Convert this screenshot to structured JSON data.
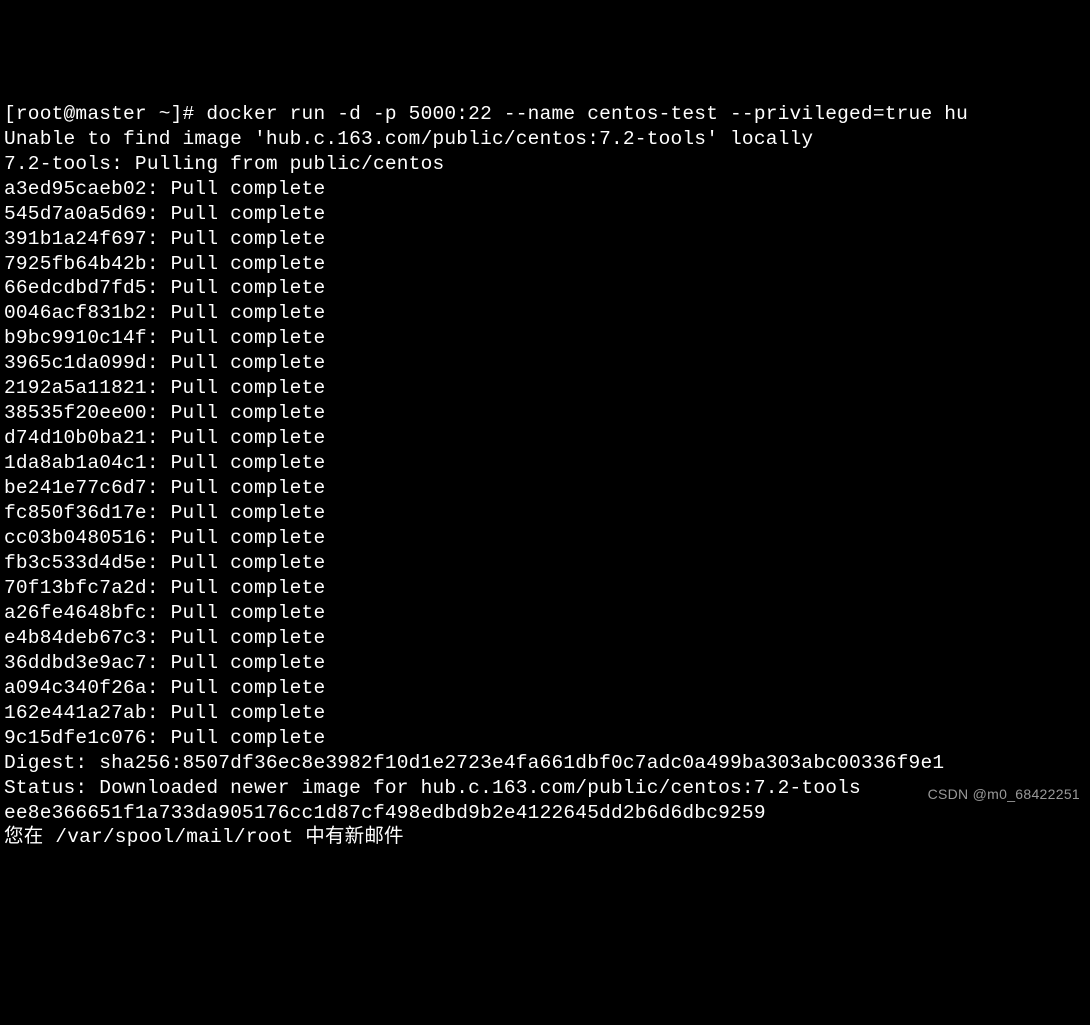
{
  "terminal": {
    "prompt_lines": [
      "[root@master ~]# docker run -d -p 5000:22 --name centos-test --privileged=true hu",
      "Unable to find image 'hub.c.163.com/public/centos:7.2-tools' locally",
      "7.2-tools: Pulling from public/centos"
    ],
    "pulls": [
      "a3ed95caeb02: Pull complete",
      "545d7a0a5d69: Pull complete",
      "391b1a24f697: Pull complete",
      "7925fb64b42b: Pull complete",
      "66edcdbd7fd5: Pull complete",
      "0046acf831b2: Pull complete",
      "b9bc9910c14f: Pull complete",
      "3965c1da099d: Pull complete",
      "2192a5a11821: Pull complete",
      "38535f20ee00: Pull complete",
      "d74d10b0ba21: Pull complete",
      "1da8ab1a04c1: Pull complete",
      "be241e77c6d7: Pull complete",
      "fc850f36d17e: Pull complete",
      "cc03b0480516: Pull complete",
      "fb3c533d4d5e: Pull complete",
      "70f13bfc7a2d: Pull complete",
      "a26fe4648bfc: Pull complete",
      "e4b84deb67c3: Pull complete",
      "36ddbd3e9ac7: Pull complete",
      "a094c340f26a: Pull complete",
      "162e441a27ab: Pull complete",
      "9c15dfe1c076: Pull complete"
    ],
    "footer_lines": [
      "Digest: sha256:8507df36ec8e3982f10d1e2723e4fa661dbf0c7adc0a499ba303abc00336f9e1",
      "Status: Downloaded newer image for hub.c.163.com/public/centos:7.2-tools",
      "ee8e366651f1a733da905176cc1d87cf498edbd9b2e4122645dd2b6d6dbc9259",
      "您在 /var/spool/mail/root 中有新邮件"
    ]
  },
  "watermark": "CSDN @m0_68422251"
}
